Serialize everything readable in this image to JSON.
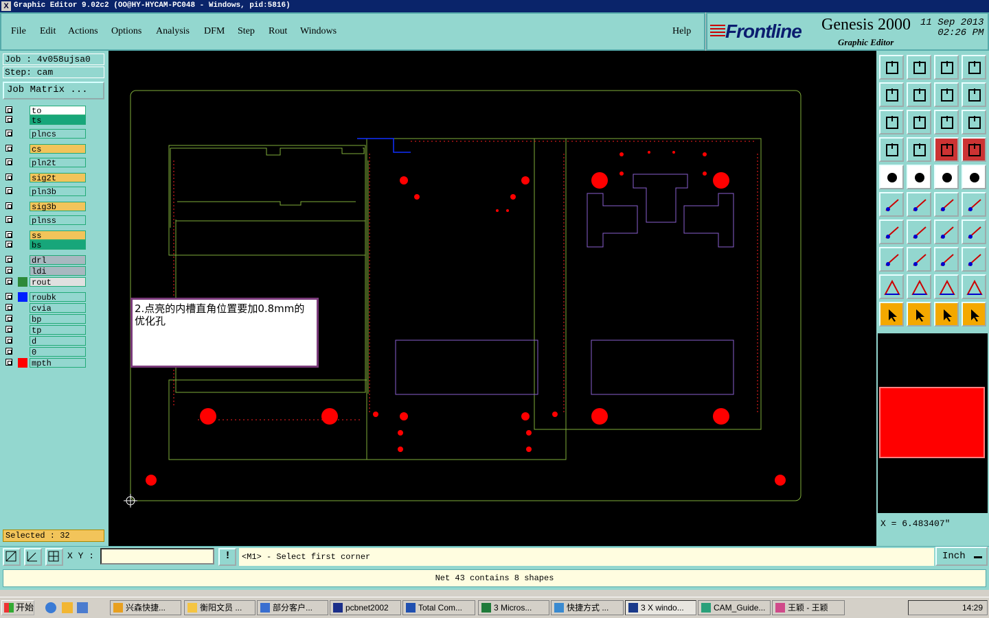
{
  "titlebar": {
    "title": "Graphic Editor 9.02c2 (OO@HY-HYCAM-PC048 - Windows, pid:5816)",
    "icon": "X"
  },
  "menu": {
    "items": [
      "File",
      "Edit",
      "Actions",
      "Options",
      "Analysis",
      "DFM",
      "Step",
      "Rout",
      "Windows"
    ],
    "help": "Help"
  },
  "brand": {
    "logo": "Frontline",
    "product": "Genesis 2000",
    "subtitle": "Graphic Editor",
    "date": "11  Sep  2013",
    "time": "02:26  PM"
  },
  "job": {
    "job_line": "Job : 4v058ujsa0",
    "step_line": "Step: cam",
    "matrix_button": "Job Matrix ..."
  },
  "layers": [
    {
      "name": "to",
      "color": "#ffffff",
      "swatch": ""
    },
    {
      "name": "ts",
      "color": "#17a67a",
      "swatch": ""
    },
    {
      "name": "plncs",
      "color": "#93d7cf",
      "swatch": ""
    },
    {
      "name": "cs",
      "color": "#f2c45a",
      "swatch": ""
    },
    {
      "name": "pln2t",
      "color": "#93d7cf",
      "swatch": ""
    },
    {
      "name": "sig2t",
      "color": "#f2c45a",
      "swatch": ""
    },
    {
      "name": "pln3b",
      "color": "#93d7cf",
      "swatch": ""
    },
    {
      "name": "sig3b",
      "color": "#f2c45a",
      "swatch": ""
    },
    {
      "name": "plnss",
      "color": "#93d7cf",
      "swatch": ""
    },
    {
      "name": "ss",
      "color": "#f2c45a",
      "swatch": ""
    },
    {
      "name": "bs",
      "color": "#17a67a",
      "swatch": ""
    },
    {
      "name": "drl",
      "color": "#a8b8c0",
      "swatch": ""
    },
    {
      "name": "ldi",
      "color": "#a8b8c0",
      "swatch": ""
    },
    {
      "name": "rout",
      "color": "#e0e0e0",
      "swatch": "#2d8a3a"
    },
    {
      "name": "roubk",
      "color": "#93d7cf",
      "swatch": "#0020ff"
    },
    {
      "name": "cvia",
      "color": "#93d7cf",
      "swatch": ""
    },
    {
      "name": "bp",
      "color": "#93d7cf",
      "swatch": ""
    },
    {
      "name": "tp",
      "color": "#93d7cf",
      "swatch": ""
    },
    {
      "name": "d",
      "color": "#93d7cf",
      "swatch": ""
    },
    {
      "name": "0",
      "color": "#93d7cf",
      "swatch": ""
    },
    {
      "name": "mpth",
      "color": "#93d7cf",
      "swatch": "#ff0000"
    }
  ],
  "selected": "Selected : 32",
  "note": {
    "text": "2.点亮的内槽直角位置要加0.8mm的优化孔"
  },
  "coord": {
    "x": "X = 6.483407\""
  },
  "cmd": {
    "xy_label": "X Y :",
    "xy_value": "",
    "prompt": "<M1> - Select first corner",
    "unit": "Inch"
  },
  "status": "Net 43 contains 8 shapes",
  "taskbar": {
    "start": "开始",
    "tasks": [
      "兴森快捷...",
      "衡阳文员 ...",
      "部分客户...",
      "pcbnet2002",
      "Total Com...",
      "3 Micros...",
      "快捷方式 ...",
      "3 X windo...",
      "CAM_Guide...",
      "王颖 - 王颖"
    ],
    "clock": "14:29"
  },
  "colors": {
    "panel": "#93d7cf",
    "canvas": "#000000",
    "profile": "#7fae3a",
    "pads": "#ff0000",
    "purple": "#8a5fd0"
  }
}
